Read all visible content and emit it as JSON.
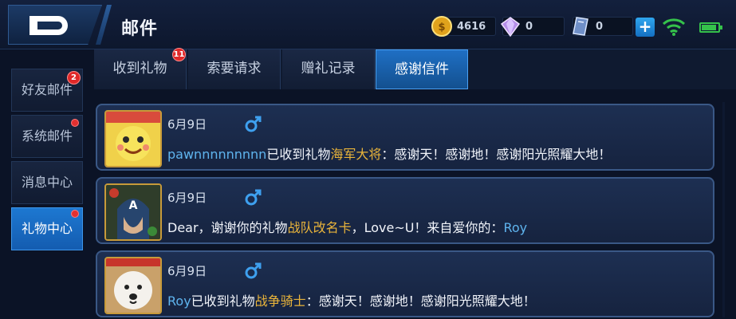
{
  "header": {
    "title": "邮件",
    "gold": "4616",
    "diamonds": "0",
    "vouchers": "0",
    "plus_label": "+"
  },
  "sidebar": {
    "items": [
      {
        "label": "好友邮件",
        "badge": "2",
        "dot": false,
        "active": false
      },
      {
        "label": "系统邮件",
        "badge": "",
        "dot": true,
        "active": false
      },
      {
        "label": "消息中心",
        "badge": "",
        "dot": false,
        "active": false
      },
      {
        "label": "礼物中心",
        "badge": "",
        "dot": true,
        "active": true
      }
    ]
  },
  "tabs": [
    {
      "label": "收到礼物",
      "badge": "11",
      "active": false
    },
    {
      "label": "索要请求",
      "badge": "",
      "active": false
    },
    {
      "label": "赠礼记录",
      "badge": "",
      "active": false
    },
    {
      "label": "感谢信件",
      "badge": "",
      "active": true
    }
  ],
  "messages": [
    {
      "date": "6月9日",
      "gender": "male",
      "parts": [
        {
          "text": "pawnnnnnnnnn",
          "style": "blue"
        },
        {
          "text": "已收到礼物",
          "style": "plain"
        },
        {
          "text": "海军大将",
          "style": "gold"
        },
        {
          "text": "：感谢天！感谢地！感谢阳光照耀大地！",
          "style": "plain"
        }
      ]
    },
    {
      "date": "6月9日",
      "gender": "male",
      "parts": [
        {
          "text": "Dear，谢谢你的礼物",
          "style": "plain"
        },
        {
          "text": "战队改名卡",
          "style": "gold"
        },
        {
          "text": "，Love~U！来自爱你的：",
          "style": "plain"
        },
        {
          "text": "Roy",
          "style": "blue"
        }
      ]
    },
    {
      "date": "6月9日",
      "gender": "male",
      "parts": [
        {
          "text": "Roy",
          "style": "blue"
        },
        {
          "text": "已收到礼物",
          "style": "plain"
        },
        {
          "text": "战争骑士",
          "style": "gold"
        },
        {
          "text": "：感谢天！感谢地！感谢阳光照耀大地！",
          "style": "plain"
        }
      ]
    }
  ],
  "colors": {
    "accent": "#1d78d1",
    "highlight_gold": "#e9b43a",
    "highlight_blue": "#5fb4ee",
    "badge": "#e02828",
    "gender_male": "#3ea0ef"
  }
}
